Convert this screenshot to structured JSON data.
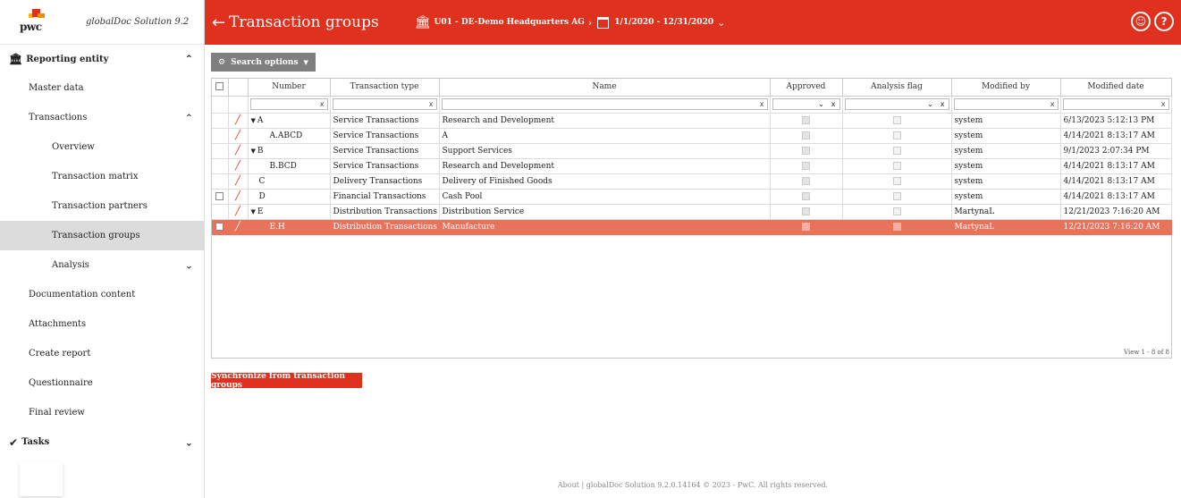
{
  "brand": {
    "logo_text": "pwc",
    "app_title": "globalDoc Solution 9.2"
  },
  "sidebar": {
    "section": "Reporting entity",
    "items": [
      {
        "label": "Master data"
      },
      {
        "label": "Transactions"
      },
      {
        "label": "Overview"
      },
      {
        "label": "Transaction matrix"
      },
      {
        "label": "Transaction partners"
      },
      {
        "label": "Transaction groups"
      },
      {
        "label": "Analysis"
      },
      {
        "label": "Documentation content"
      },
      {
        "label": "Attachments"
      },
      {
        "label": "Create report"
      },
      {
        "label": "Questionnaire"
      },
      {
        "label": "Final review"
      }
    ],
    "tasks": "Tasks"
  },
  "header": {
    "title": "Transaction groups",
    "entity": "U01 - DE-Demo Headquarters AG",
    "period": "1/1/2020 - 12/31/2020",
    "profile_icon": "☺",
    "help_icon": "?"
  },
  "toolbar": {
    "search_options": "Search options"
  },
  "grid": {
    "columns": [
      "Number",
      "Transaction type",
      "Name",
      "Approved",
      "Analysis flag",
      "Modified by",
      "Modified date"
    ],
    "filter_clear": "x",
    "rows": [
      {
        "number": "A",
        "expand": true,
        "type": "Service Transactions",
        "name": "Research and Development",
        "modified_by": "system",
        "modified_date": "6/13/2023 5:12:13 PM",
        "checkbox": false
      },
      {
        "number": "A.ABCD",
        "expand": false,
        "type": "Service Transactions",
        "name": "A",
        "modified_by": "system",
        "modified_date": "4/14/2021 8:13:17 AM",
        "checkbox": false
      },
      {
        "number": "B",
        "expand": true,
        "type": "Service Transactions",
        "name": "Support Services",
        "modified_by": "system",
        "modified_date": "9/1/2023 2:07:34 PM",
        "checkbox": false
      },
      {
        "number": "B.BCD",
        "expand": false,
        "type": "Service Transactions",
        "name": "Research and Development",
        "modified_by": "system",
        "modified_date": "4/14/2021 8:13:17 AM",
        "checkbox": false
      },
      {
        "number": "C",
        "expand": false,
        "type": "Delivery Transactions",
        "name": "Delivery of Finished Goods",
        "modified_by": "system",
        "modified_date": "4/14/2021 8:13:17 AM",
        "checkbox": false
      },
      {
        "number": "D",
        "expand": false,
        "type": "Financial Transactions",
        "name": "Cash Pool",
        "modified_by": "system",
        "modified_date": "4/14/2021 8:13:17 AM",
        "checkbox": true
      },
      {
        "number": "E",
        "expand": true,
        "type": "Distribution Transactions",
        "name": "Distribution Service",
        "modified_by": "MartynaL",
        "modified_date": "12/21/2023 7:16:20 AM",
        "checkbox": false
      },
      {
        "number": "E.H",
        "expand": false,
        "type": "Distribution Transactions",
        "name": "Manufacture",
        "modified_by": "MartynaL",
        "modified_date": "12/21/2023 7:16:20 AM",
        "checkbox": true,
        "selected": true
      }
    ],
    "view_count": "View 1 - 8 of 8"
  },
  "sync_button": "Synchronize from transaction groups",
  "footer": "About | globalDoc Solution 9.2.0.14164 © 2023 - PwC. All rights reserved.",
  "colors": {
    "accent": "#e0301e",
    "selected_row": "#e8735b"
  }
}
